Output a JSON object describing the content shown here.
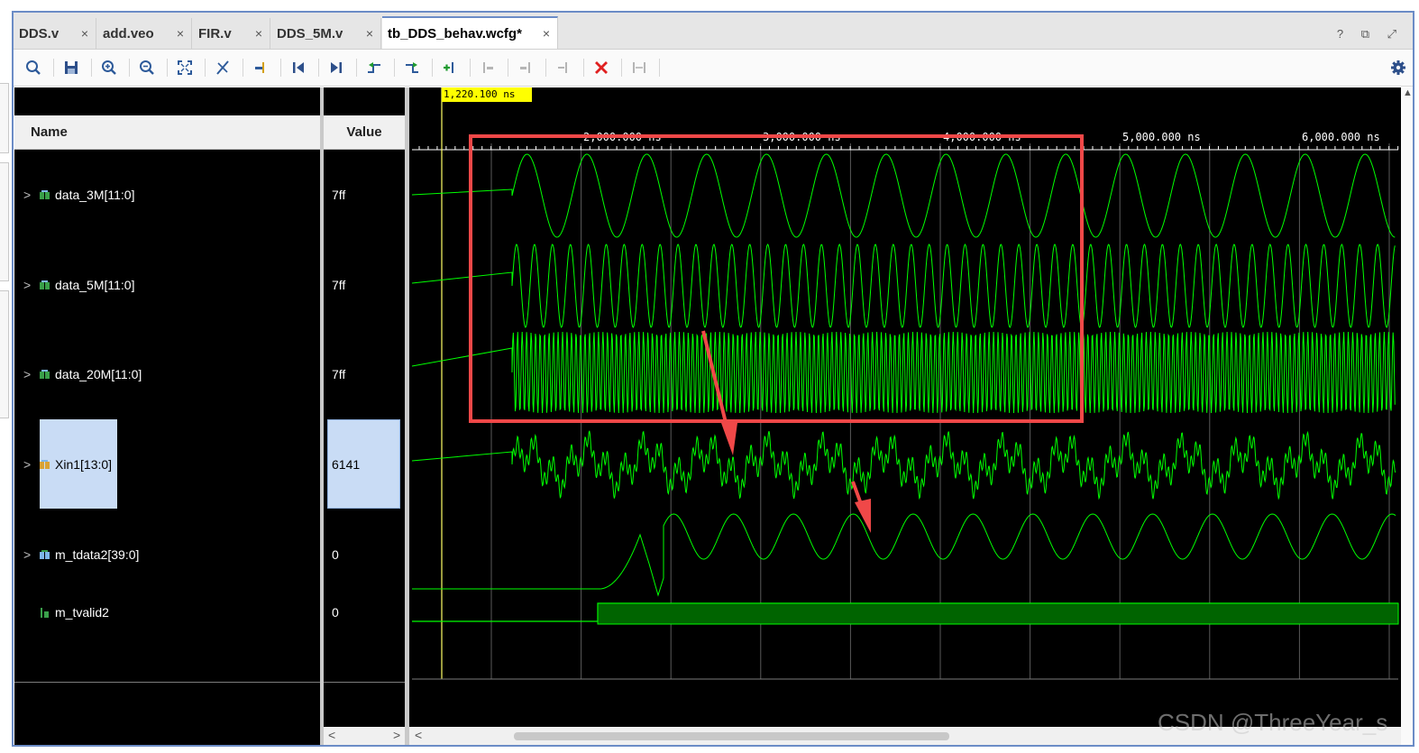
{
  "tabs": [
    {
      "label": "DDS.v",
      "active": false
    },
    {
      "label": "add.veo",
      "active": false
    },
    {
      "label": "FIR.v",
      "active": false
    },
    {
      "label": "DDS_5M.v",
      "active": false
    },
    {
      "label": "tb_DDS_behav.wcfg*",
      "active": true
    }
  ],
  "tab_close_glyph": "×",
  "window_controls": "? ⧉ ⤢",
  "toolbar": {
    "icons": [
      "search-icon",
      "save-icon",
      "zoom-in-icon",
      "zoom-out-icon",
      "zoom-fit-icon",
      "cursor-snap-icon",
      "goto-cursor-icon",
      "go-first-icon",
      "go-last-icon",
      "prev-transition-icon",
      "next-transition-icon",
      "add-marker-icon",
      "prev-marker-icon",
      "next-marker-icon",
      "swap-cursors-icon",
      "delete-marker-icon",
      "marker-range-icon",
      "settings-icon"
    ]
  },
  "columns": {
    "name": "Name",
    "value": "Value"
  },
  "signals": [
    {
      "name": "data_3M[11:0]",
      "value": "7ff",
      "expandable": true,
      "icon": "bus-icon"
    },
    {
      "name": "data_5M[11:0]",
      "value": "7ff",
      "expandable": true,
      "icon": "bus-icon"
    },
    {
      "name": "data_20M[11:0]",
      "value": "7ff",
      "expandable": true,
      "icon": "bus-icon"
    },
    {
      "name": "Xin1[13:0]",
      "value": "6141",
      "expandable": true,
      "icon": "bus-icon",
      "selected": true
    },
    {
      "name": "m_tdata2[39:0]",
      "value": "0",
      "expandable": true,
      "icon": "bus-icon"
    },
    {
      "name": "m_tvalid2",
      "value": "0",
      "expandable": false,
      "icon": "bit-icon"
    }
  ],
  "cursor": {
    "label": "1,220.100 ns"
  },
  "timeline": {
    "labels": [
      "2,000.000 ns",
      "3,000.000 ns",
      "4,000.000 ns",
      "5,000.000 ns",
      "6,000.000 ns"
    ]
  },
  "colors": {
    "wave": "#00ff00",
    "cursor": "#ffff00",
    "annotation": "#f04848",
    "selection": "#c9dcf5"
  },
  "watermark": "CSDN @ThreeYear_s"
}
